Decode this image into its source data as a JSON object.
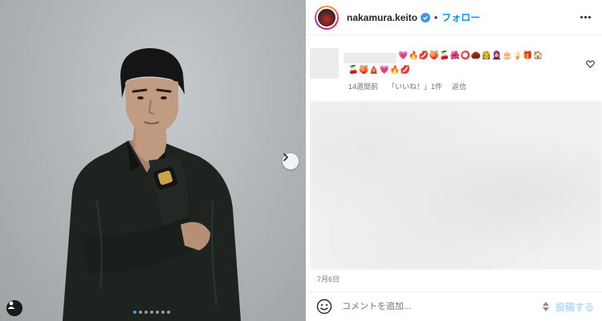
{
  "post": {
    "media_dots": 7,
    "active_dot": 0
  },
  "header": {
    "username": "nakamura.keito",
    "separator": "•",
    "follow_label": "フォロー"
  },
  "comment": {
    "emoji_line1": "💗🔥💋🍑🍒🌺⭕🌰👸🧕🎂🍦🎁🏠",
    "emoji_line2": "🍒🍑🛕💗🔥💋",
    "time_ago": "14週間前",
    "likes": "「いいね！」1件",
    "reply_label": "返信"
  },
  "post_date": "7月6日",
  "compose": {
    "placeholder": "コメントを追加...",
    "post_label": "投稿する"
  },
  "icons": {
    "next": "chevron-right-icon",
    "user_tag": "user-icon",
    "more": "more-horizontal-icon",
    "heart": "heart-icon",
    "verified": "verified-badge-icon",
    "smiley": "smiley-icon",
    "stepper": "up-down-arrows-icon"
  },
  "colors": {
    "accent": "#0095f6",
    "post_disabled": "#b3dbff",
    "active_dot": "#4d9be6"
  }
}
